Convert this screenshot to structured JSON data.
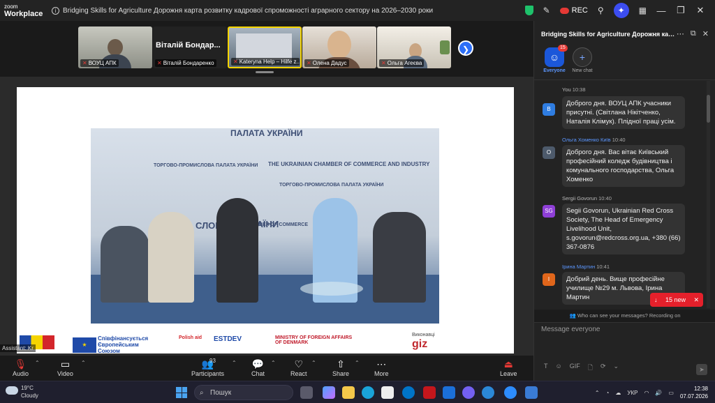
{
  "app": {
    "logo_line1": "zoom",
    "logo_line2": "Workplace",
    "meeting_title": "Bridging Skills for Agriculture  Дорожня карта розвитку кадрової спроможності аграрного сектору на 2026–2030 роки",
    "rec_label": "REC"
  },
  "participants_strip": {
    "tiles": [
      {
        "name": "ВОУЦ АПК"
      },
      {
        "name": "Віталій Бондаренко",
        "display": "Віталій Бондар..."
      },
      {
        "name": "Kateryna Help – Hilfe z..."
      },
      {
        "name": "Олена Дадус"
      },
      {
        "name": "Ольга Агеєва"
      }
    ]
  },
  "slide": {
    "wall_texts": [
      "ПАЛАТА УКРАЇНИ",
      "THE UKRAINIAN CHAMBER OF COMMERCE AND INDUSTRY",
      "ТОРГОВО-ПРОМИСЛОВА ПАЛАТА УКРАЇНИ",
      "ТОРГОВО-ПРОМИСЛОВА ПАЛАТА УКРАЇНИ",
      "CHAMBER OF COMMERCE",
      "СЛОВ",
      "РАЇНИ"
    ],
    "logos": {
      "eu_text": "Співфінансується Європейським Союзом",
      "estdev": "ESTDEV",
      "polish": "Polish aid",
      "denmark": "MINISTRY OF FOREIGN AFFAIRS OF DENMARK",
      "implementer": "Виконавці",
      "giz": "giz"
    }
  },
  "assistant_tag": "Assistant: Kr",
  "toolbar": {
    "audio": "Audio",
    "video": "Video",
    "participants": "Participants",
    "participants_count": "93",
    "chat": "Chat",
    "react": "React",
    "share": "Share",
    "more": "More",
    "leave": "Leave"
  },
  "chat": {
    "title": "Bridging Skills for Agriculture  Дорожня карта розвитку кадрової спроможності",
    "tabs": [
      {
        "label": "Everyone",
        "badge": "15"
      },
      {
        "label": "New chat"
      }
    ],
    "messages": [
      {
        "initial": "В",
        "name": "You",
        "time": "10:38",
        "color": "#2f7de1",
        "text": "Доброго дня. ВОУЦ АПК учасники присутні. (Світлана Нікітченко, Наталія Клімук). Плідної праці усім."
      },
      {
        "initial": "О",
        "name": "Ольга Хоменко Київ",
        "time": "10:40",
        "color": "#4d5a6b",
        "text": "Доброго дня. Вас вітає Київський професійний коледж будівництва і комунального господарства, Ольга Хоменко"
      },
      {
        "initial": "SG",
        "name": "Sergii Govorun",
        "time": "10:40",
        "color": "#8e3fd6",
        "text": "Segii Govorun, Ukrainian Red Cross Society, The Head of Emergency Livelihood Unit, s.govorun@redcross.org.ua, +380 (66) 367-0876"
      },
      {
        "initial": "І",
        "name": "Ірина Мартин",
        "time": "10:41",
        "color": "#e0661b",
        "text": "Добрий день. Вище професійне училище №29 м. Львова, Ірина Мартин"
      }
    ],
    "new_pill": "15 new",
    "who_can_see": "Who can see your messages? Recording on",
    "compose_placeholder": "Message everyone",
    "compose_tools": [
      "T",
      "☺",
      "GIF",
      "🗋",
      "⟳",
      "⌄"
    ]
  },
  "taskbar": {
    "temperature": "19°C",
    "weather": "Cloudy",
    "search_placeholder": "Пошук",
    "lang": "УКР",
    "time": "12:38",
    "date": "07.07.2026"
  }
}
